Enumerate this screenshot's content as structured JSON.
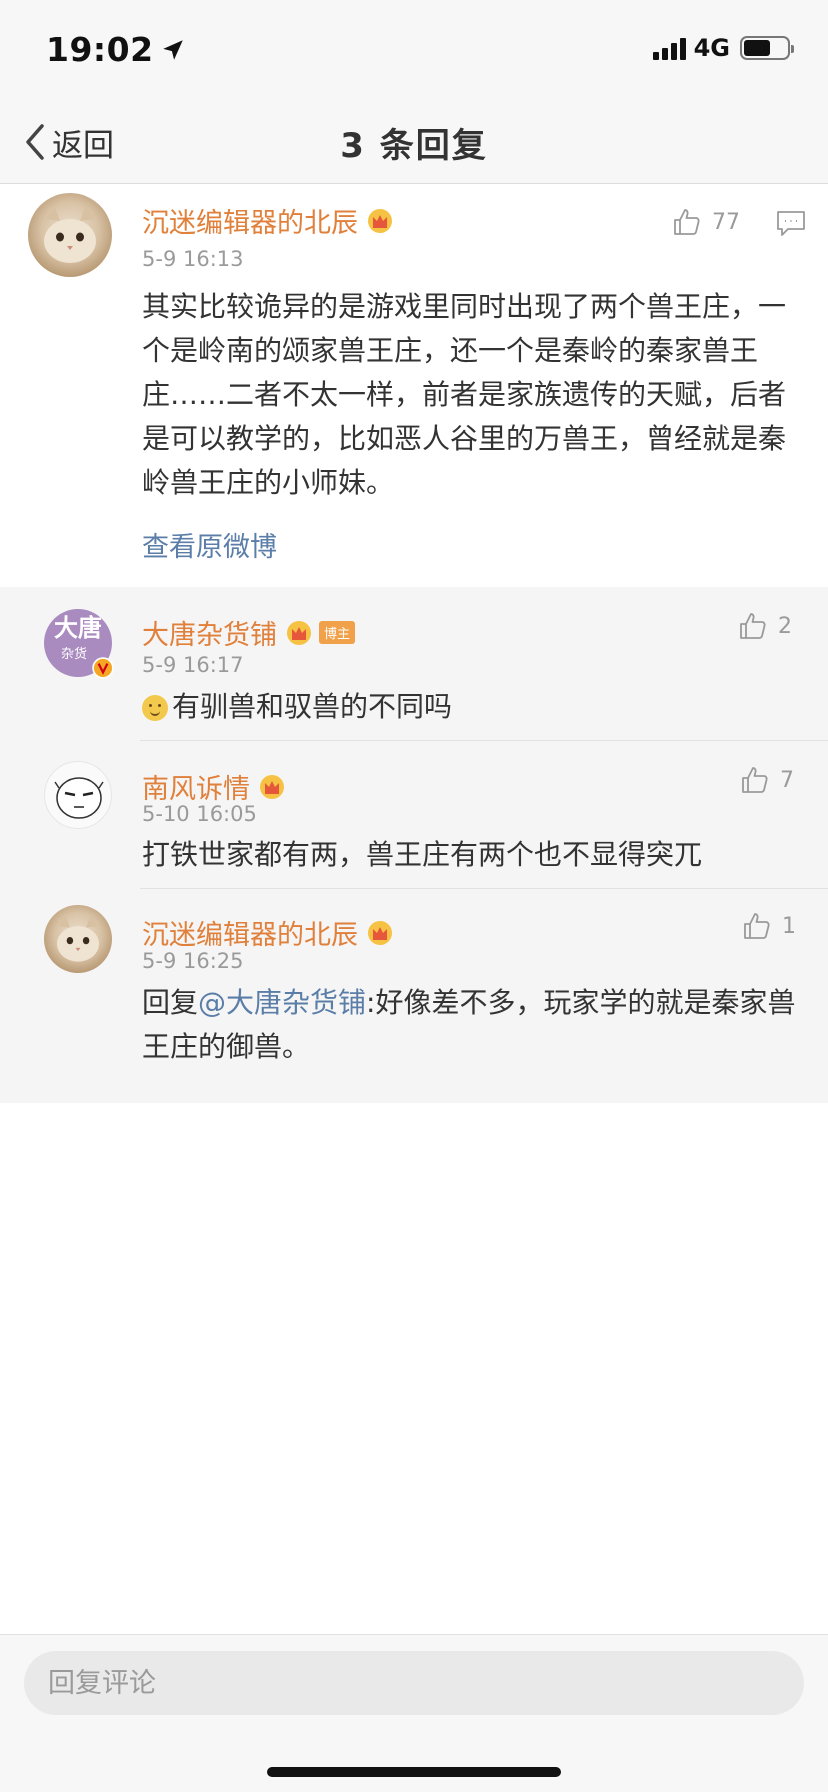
{
  "status_bar": {
    "time": "19:02",
    "network": "4G",
    "battery_level": 0.62
  },
  "nav": {
    "back_label": "返回",
    "title": "3 条回复"
  },
  "main_comment": {
    "username": "沉迷编辑器的北辰",
    "timestamp": "5-9 16:13",
    "likes": "77",
    "text": "其实比较诡异的是游戏里同时出现了两个兽王庄，一个是岭南的颂家兽王庄，还一个是秦岭的秦家兽王庄……二者不太一样，前者是家族遗传的天赋，后者是可以教学的，比如恶人谷里的万兽王，曾经就是秦岭兽王庄的小师妹。",
    "view_original": "查看原微博"
  },
  "replies": [
    {
      "username": "大唐杂货铺",
      "badge": "博主",
      "avatar_text_top": "大唐",
      "avatar_text_bottom": "杂货",
      "timestamp": "5-9 16:17",
      "likes": "2",
      "text": "有驯兽和驭兽的不同吗"
    },
    {
      "username": "南风诉情",
      "timestamp": "5-10 16:05",
      "likes": "7",
      "text": "打铁世家都有两，兽王庄有两个也不显得突兀"
    },
    {
      "username": "沉迷编辑器的北辰",
      "timestamp": "5-9 16:25",
      "likes": "1",
      "text_prefix": "回复",
      "mention": "@大唐杂货铺",
      "text_rest": ":好像差不多，玩家学的就是秦家兽王庄的御兽。"
    }
  ],
  "bottom": {
    "placeholder": "回复评论"
  },
  "colors": {
    "username": "#e0803a",
    "link": "#5b7ea8",
    "meta": "#9a9a9a"
  }
}
